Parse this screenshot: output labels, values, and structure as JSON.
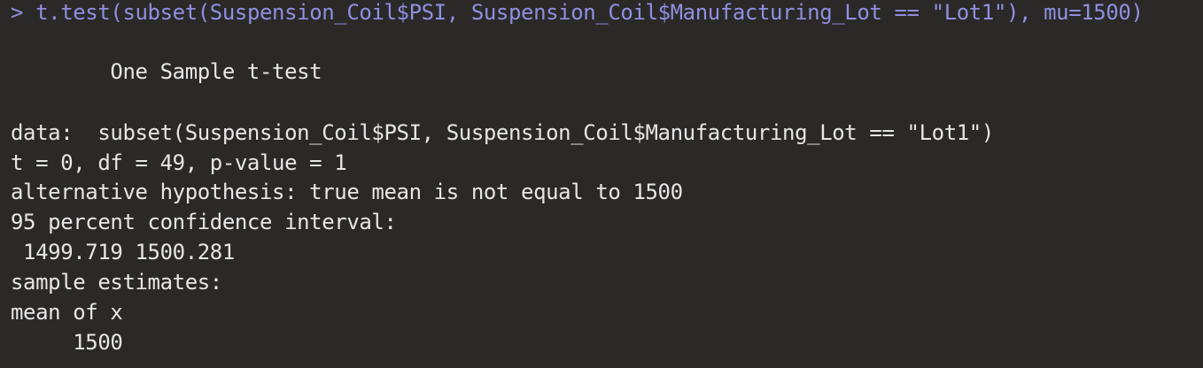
{
  "console": {
    "command": {
      "prompt": "> ",
      "text": "t.test(subset(Suspension_Coil$PSI, Suspension_Coil$Manufacturing_Lot == \"Lot1\"), mu=1500)"
    },
    "output": {
      "title": "        One Sample t-test",
      "data_line": "data:  subset(Suspension_Coil$PSI, Suspension_Coil$Manufacturing_Lot == \"Lot1\")",
      "stats_line": "t = 0, df = 49, p-value = 1",
      "alternative_line": "alternative hypothesis: true mean is not equal to 1500",
      "ci_label": "95 percent confidence interval:",
      "ci_values": " 1499.719 1500.281",
      "estimates_label": "sample estimates:",
      "mean_label": "mean of x",
      "mean_value": "     1500"
    },
    "colors": {
      "background": "#2b2928",
      "command": "#8f8fe0",
      "output": "#e6e6e6"
    }
  }
}
